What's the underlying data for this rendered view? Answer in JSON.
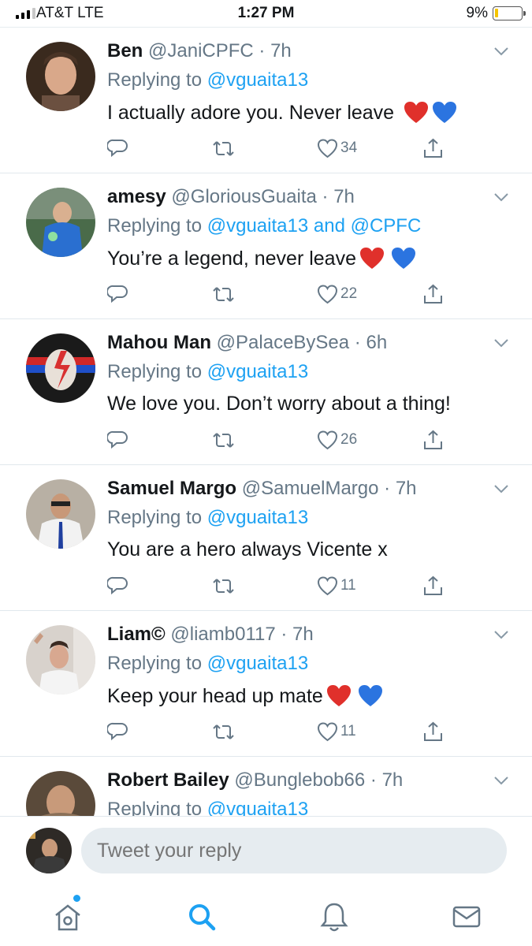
{
  "status_bar": {
    "carrier": "AT&T  LTE",
    "time": "1:27 PM",
    "battery": "9%",
    "battery_level": 0.09
  },
  "colors": {
    "link": "#1da1f2",
    "muted": "#657786",
    "text": "#14171a",
    "divider": "#e1e8ed",
    "reply_bg": "#e6ecf0"
  },
  "tweets": [
    {
      "name": "Ben",
      "handle": "@JaniCPFC",
      "time": "7h",
      "replying_prefix": "Replying to ",
      "replying_to": "@vguaita13",
      "text": "I actually adore you. Never leave",
      "emojis": [
        "red-heart",
        "blue-heart"
      ],
      "likes": "34"
    },
    {
      "name": "amesy",
      "handle": "@GloriousGuaita",
      "time": "7h",
      "replying_prefix": "Replying to ",
      "replying_to": "@vguaita13 and @CPFC",
      "text": "You’re a legend, never leave",
      "emojis": [
        "red-heart",
        "blue-heart"
      ],
      "likes": "22"
    },
    {
      "name": "Mahou Man",
      "handle": "@PalaceBySea",
      "time": "6h",
      "replying_prefix": "Replying to ",
      "replying_to": "@vguaita13",
      "text": "We love you. Don’t worry about a thing!",
      "emojis": [],
      "likes": "26"
    },
    {
      "name": "Samuel Margo",
      "handle": "@SamuelMargo",
      "time": "7h",
      "replying_prefix": "Replying to ",
      "replying_to": "@vguaita13",
      "text": "You are a hero always Vicente x",
      "emojis": [],
      "likes": "11"
    },
    {
      "name": "Liam©",
      "handle": "@liamb0117",
      "time": "7h",
      "replying_prefix": "Replying to ",
      "replying_to": "@vguaita13",
      "text": "Keep your head up mate",
      "emojis": [
        "red-heart",
        "blue-heart"
      ],
      "likes": "11"
    },
    {
      "name": "Robert Bailey",
      "handle": "@Bunglebob66",
      "time": "7h",
      "replying_prefix": "Replying to ",
      "replying_to": "@vguaita13",
      "text": "",
      "emojis": [],
      "likes": ""
    }
  ],
  "composer": {
    "placeholder": "Tweet your reply"
  },
  "tabbar": {
    "items": [
      "home-icon",
      "search-icon",
      "bell-icon",
      "mail-icon"
    ],
    "active": "search-icon"
  }
}
